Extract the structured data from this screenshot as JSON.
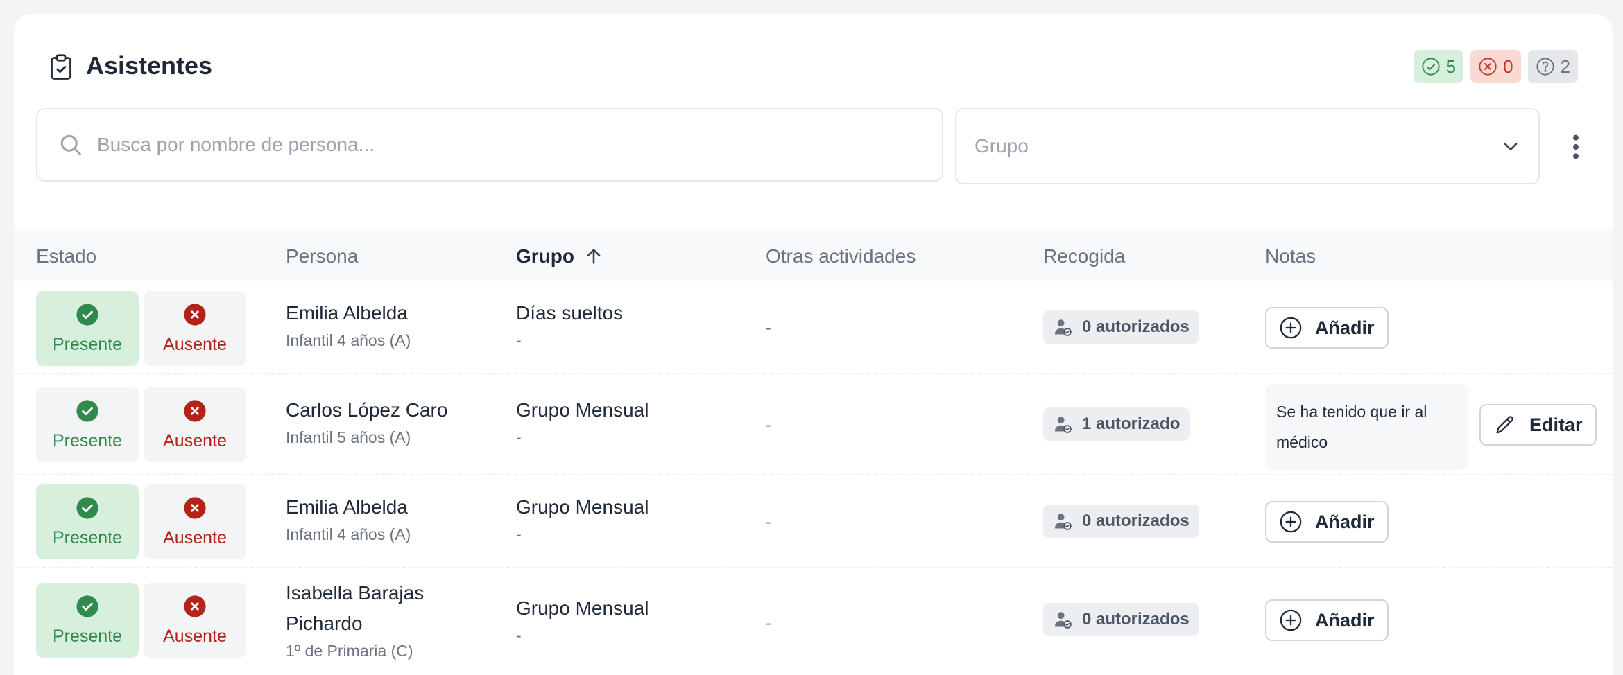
{
  "header": {
    "title": "Asistentes",
    "badges": {
      "present": "5",
      "absent": "0",
      "unknown": "2"
    }
  },
  "filters": {
    "search_placeholder": "Busca por nombre de persona...",
    "group_placeholder": "Grupo"
  },
  "table": {
    "columns": [
      "Estado",
      "Persona",
      "Grupo",
      "Otras actividades",
      "Recogida",
      "Notas"
    ],
    "sorted_column": "Grupo",
    "sort_direction": "asc",
    "present_label": "Presente",
    "absent_label": "Ausente",
    "add_label": "Añadir",
    "edit_label": "Editar",
    "rows": [
      {
        "status": "present",
        "name": "Emilia Albelda",
        "class": "Infantil 4 años (A)",
        "group": "Días sueltos",
        "group_sub": "-",
        "other": "-",
        "pickup": "0 autorizados",
        "note": ""
      },
      {
        "status": "none",
        "name": "Carlos López Caro",
        "class": "Infantil 5 años (A)",
        "group": "Grupo Mensual",
        "group_sub": "-",
        "other": "-",
        "pickup": "1 autorizado",
        "note": "Se ha tenido que ir al médico"
      },
      {
        "status": "present",
        "name": "Emilia Albelda",
        "class": "Infantil 4 años (A)",
        "group": "Grupo Mensual",
        "group_sub": "-",
        "other": "-",
        "pickup": "0 autorizados",
        "note": ""
      },
      {
        "status": "present",
        "name": "Isabella Barajas Pichardo",
        "class": "1º de Primaria (C)",
        "group": "Grupo Mensual",
        "group_sub": "-",
        "other": "-",
        "pickup": "0 autorizados",
        "note": ""
      }
    ]
  },
  "colors": {
    "present_green": "#2f8a4c",
    "present_bg": "#d7f0dd",
    "absent_red": "#b42318"
  }
}
